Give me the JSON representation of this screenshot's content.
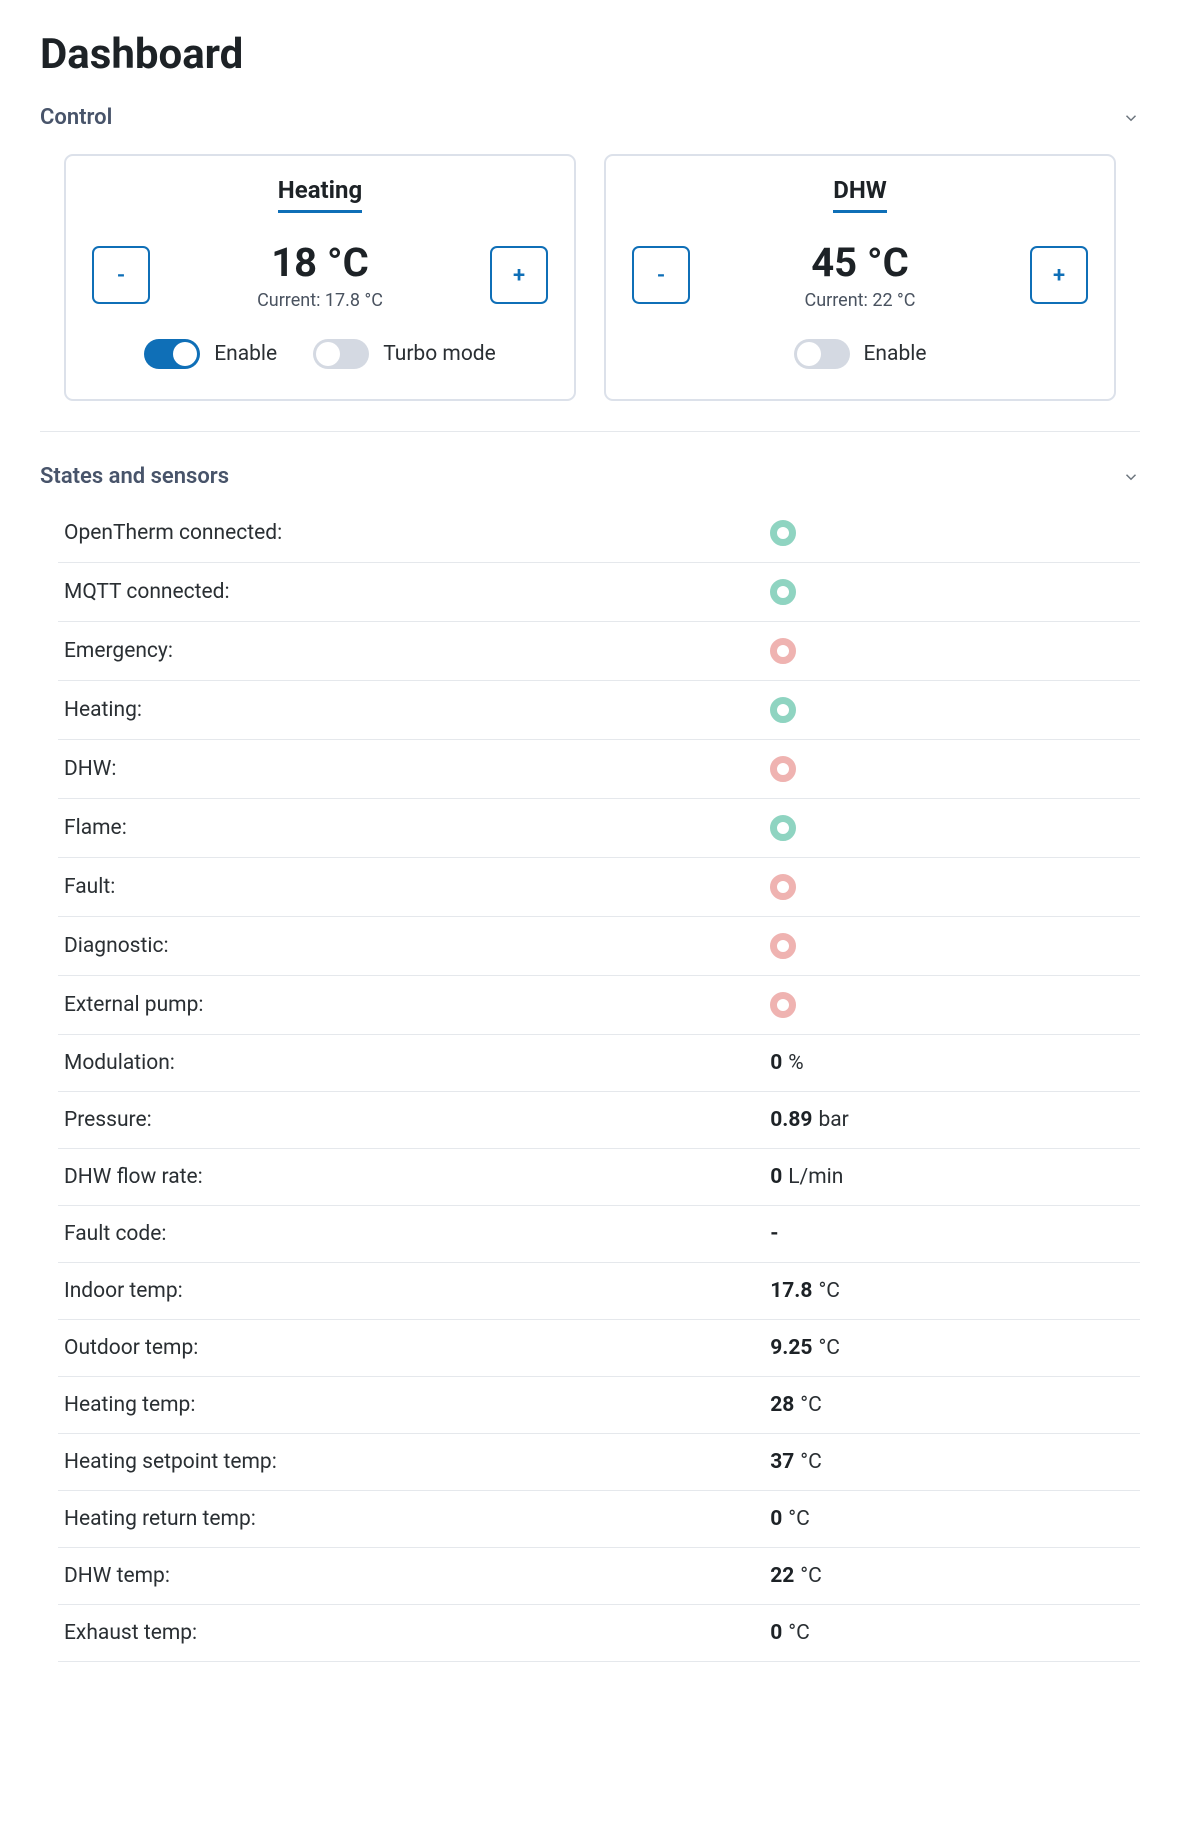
{
  "pageTitle": "Dashboard",
  "sections": {
    "control": {
      "title": "Control"
    },
    "states": {
      "title": "States and sensors"
    }
  },
  "control": {
    "heating": {
      "title": "Heating",
      "setpoint": "18 °C",
      "currentLabel": "Current: 17.8 °C",
      "decrLabel": "-",
      "incrLabel": "+",
      "enable": {
        "label": "Enable",
        "on": true
      },
      "turbo": {
        "label": "Turbo mode",
        "on": false
      }
    },
    "dhw": {
      "title": "DHW",
      "setpoint": "45 °C",
      "currentLabel": "Current: 22 °C",
      "decrLabel": "-",
      "incrLabel": "+",
      "enable": {
        "label": "Enable",
        "on": false
      }
    }
  },
  "states": [
    {
      "label": "OpenTherm connected:",
      "type": "indicator",
      "status": "green"
    },
    {
      "label": "MQTT connected:",
      "type": "indicator",
      "status": "green"
    },
    {
      "label": "Emergency:",
      "type": "indicator",
      "status": "red"
    },
    {
      "label": "Heating:",
      "type": "indicator",
      "status": "green"
    },
    {
      "label": "DHW:",
      "type": "indicator",
      "status": "red"
    },
    {
      "label": "Flame:",
      "type": "indicator",
      "status": "green"
    },
    {
      "label": "Fault:",
      "type": "indicator",
      "status": "red"
    },
    {
      "label": "Diagnostic:",
      "type": "indicator",
      "status": "red"
    },
    {
      "label": "External pump:",
      "type": "indicator",
      "status": "red"
    },
    {
      "label": "Modulation:",
      "type": "value",
      "num": "0",
      "unit": "%"
    },
    {
      "label": "Pressure:",
      "type": "value",
      "num": "0.89",
      "unit": "bar"
    },
    {
      "label": "DHW flow rate:",
      "type": "value",
      "num": "0",
      "unit": "L/min"
    },
    {
      "label": "Fault code:",
      "type": "value",
      "num": "-",
      "unit": ""
    },
    {
      "label": "Indoor temp:",
      "type": "value",
      "num": "17.8",
      "unit": "°C"
    },
    {
      "label": "Outdoor temp:",
      "type": "value",
      "num": "9.25",
      "unit": "°C"
    },
    {
      "label": "Heating temp:",
      "type": "value",
      "num": "28",
      "unit": "°C"
    },
    {
      "label": "Heating setpoint temp:",
      "type": "value",
      "num": "37",
      "unit": "°C"
    },
    {
      "label": "Heating return temp:",
      "type": "value",
      "num": "0",
      "unit": "°C"
    },
    {
      "label": "DHW temp:",
      "type": "value",
      "num": "22",
      "unit": "°C"
    },
    {
      "label": "Exhaust temp:",
      "type": "value",
      "num": "0",
      "unit": "°C"
    }
  ]
}
